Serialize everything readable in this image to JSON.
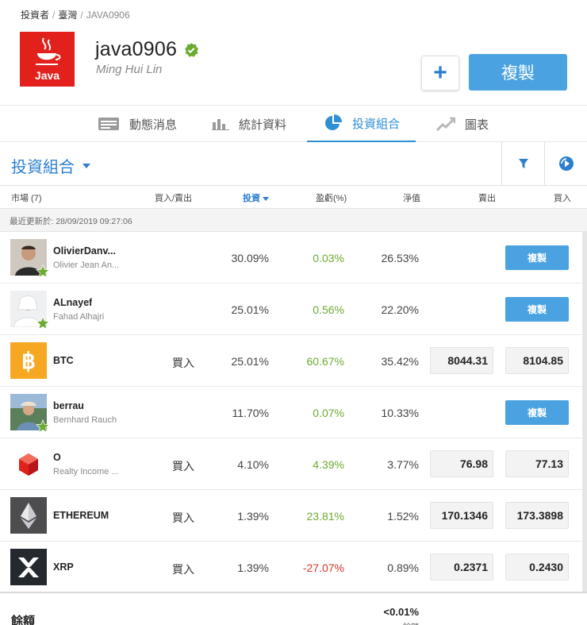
{
  "breadcrumb": {
    "item1": "投資者",
    "item2": "臺灣",
    "item3": "JAVA0906",
    "sep": "/"
  },
  "profile": {
    "username": "java0906",
    "fullname": "Ming Hui Lin",
    "avatar_text": "Java",
    "plus_label": "+",
    "copy_label": "複製"
  },
  "tabs": [
    {
      "label": "動態消息",
      "icon": "news-feed-icon"
    },
    {
      "label": "統計資料",
      "icon": "bar-chart-icon"
    },
    {
      "label": "投資組合",
      "icon": "pie-chart-icon",
      "active": true
    },
    {
      "label": "圖表",
      "icon": "line-chart-icon"
    }
  ],
  "portfolio": {
    "title": "投資組合",
    "filter_icon": "filter-icon",
    "refresh_icon": "refresh-icon"
  },
  "columns": {
    "market": "市場 (7)",
    "buy_sell": "買入/賣出",
    "invest": "投資",
    "pl": "盈虧(%)",
    "value": "淨值",
    "sell": "賣出",
    "buy": "買入"
  },
  "updated": "最近更新於: 28/09/2019 09:27:06",
  "rows": [
    {
      "name": "OlivierDanv...",
      "sub": "Olivier Jean An...",
      "action": "",
      "invest": "30.09%",
      "pl": "0.03%",
      "pl_sign": "pos",
      "value": "26.53%",
      "sell": "",
      "buy": "",
      "copy": "複製",
      "kind": "person"
    },
    {
      "name": "ALnayef",
      "sub": "Fahad Alhajri",
      "action": "",
      "invest": "25.01%",
      "pl": "0.56%",
      "pl_sign": "pos",
      "value": "22.20%",
      "sell": "",
      "buy": "",
      "copy": "複製",
      "kind": "person"
    },
    {
      "name": "BTC",
      "sub": "",
      "action": "買入",
      "invest": "25.01%",
      "pl": "60.67%",
      "pl_sign": "pos",
      "value": "35.42%",
      "sell": "8044.31",
      "buy": "8104.85",
      "copy": "",
      "kind": "btc"
    },
    {
      "name": "berrau",
      "sub": "Bernhard Rauch",
      "action": "",
      "invest": "11.70%",
      "pl": "0.07%",
      "pl_sign": "pos",
      "value": "10.33%",
      "sell": "",
      "buy": "",
      "copy": "複製",
      "kind": "person"
    },
    {
      "name": "O",
      "sub": "Realty Income ...",
      "action": "買入",
      "invest": "4.10%",
      "pl": "4.39%",
      "pl_sign": "pos",
      "value": "3.77%",
      "sell": "76.98",
      "buy": "77.13",
      "copy": "",
      "kind": "realty"
    },
    {
      "name": "ETHEREUM",
      "sub": "",
      "action": "買入",
      "invest": "1.39%",
      "pl": "23.81%",
      "pl_sign": "pos",
      "value": "1.52%",
      "sell": "170.1346",
      "buy": "173.3898",
      "copy": "",
      "kind": "eth"
    },
    {
      "name": "XRP",
      "sub": "",
      "action": "買入",
      "invest": "1.39%",
      "pl": "-27.07%",
      "pl_sign": "neg",
      "value": "0.89%",
      "sell": "0.2371",
      "buy": "0.2430",
      "copy": "",
      "kind": "xrp"
    }
  ],
  "balance": {
    "label": "餘額",
    "value": "<0.01%",
    "sub": "餘額"
  },
  "colors": {
    "accent": "#2c7fcf",
    "button": "#4aa3e0",
    "positive": "#6bab30",
    "negative": "#d9342b"
  }
}
